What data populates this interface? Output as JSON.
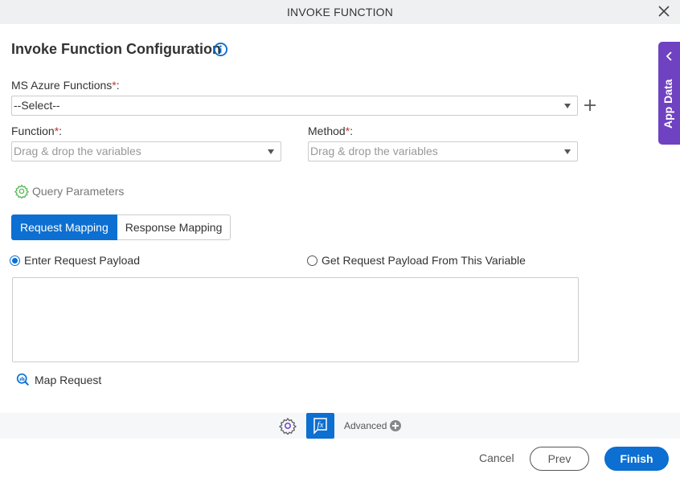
{
  "window": {
    "title": "INVOKE FUNCTION",
    "close_icon": "close-icon"
  },
  "header": {
    "title": "Invoke Function Configuration",
    "info_icon": "info-icon"
  },
  "side_panel": {
    "label": "App Data",
    "icon": "chevron-left-icon"
  },
  "fields": {
    "azure_functions": {
      "label": "MS Azure Functions",
      "required": "*",
      "suffix": ":",
      "value": "--Select--",
      "add_icon": "plus-icon"
    },
    "function": {
      "label": "Function",
      "required": "*",
      "suffix": ":",
      "placeholder": "Drag & drop the variables"
    },
    "method": {
      "label": "Method",
      "required": "*",
      "suffix": ":",
      "placeholder": "Drag & drop the variables"
    }
  },
  "query_parameters": {
    "label": "Query Parameters",
    "icon": "gear-icon"
  },
  "tabs": [
    {
      "label": "Request Mapping",
      "active": true
    },
    {
      "label": "Response Mapping",
      "active": false
    }
  ],
  "payload_options": [
    {
      "label": "Enter Request Payload",
      "selected": true
    },
    {
      "label": "Get Request Payload From This Variable",
      "selected": false
    }
  ],
  "payload": {
    "value": ""
  },
  "map_request": {
    "label": "Map Request",
    "icon": "map-search-icon"
  },
  "advanced_bar": {
    "label": "Advanced",
    "gear_icon": "gear-icon",
    "fx_icon": "function-icon",
    "plus_icon": "plus-circle-icon"
  },
  "footer": {
    "cancel": "Cancel",
    "prev": "Prev",
    "finish": "Finish"
  },
  "colors": {
    "primary": "#0c6fd1",
    "side_panel": "#6f42c1",
    "required": "#c0392b",
    "query_gear": "#5cb85c"
  }
}
